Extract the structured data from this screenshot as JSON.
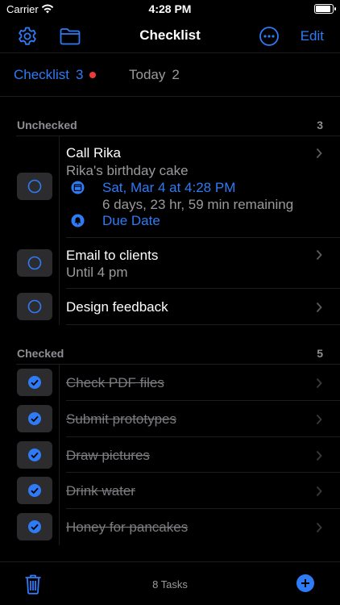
{
  "status_bar": {
    "carrier": "Carrier",
    "time": "4:28 PM"
  },
  "nav": {
    "title": "Checklist",
    "edit_label": "Edit"
  },
  "tabs": [
    {
      "label": "Checklist",
      "count": "3",
      "has_dot": true
    },
    {
      "label": "Today",
      "count": "2"
    }
  ],
  "unchecked": {
    "label": "Unchecked",
    "count": "3",
    "items": [
      {
        "title": "Call Rika",
        "note": "Rika's birthday cake",
        "date": "Sat, Mar 4 at 4:28 PM",
        "remaining": "6 days, 23 hr, 59 min remaining",
        "due_label": "Due Date"
      },
      {
        "title": "Email to clients",
        "note": "Until 4 pm"
      },
      {
        "title": "Design feedback"
      }
    ]
  },
  "checked": {
    "label": "Checked",
    "count": "5",
    "items": [
      {
        "title": "Check PDF files"
      },
      {
        "title": "Submit prototypes"
      },
      {
        "title": "Draw pictures"
      },
      {
        "title": "Drink water"
      },
      {
        "title": "Honey for pancakes"
      }
    ]
  },
  "toolbar": {
    "task_count": "8 Tasks"
  },
  "colors": {
    "accent": "#2f7bf6",
    "dot": "#f03a3a",
    "background": "#000000"
  },
  "icons": [
    "wifi-icon",
    "battery-icon",
    "gear-icon",
    "folder-icon",
    "more-icon",
    "calendar-icon",
    "bell-icon",
    "chevron-right-icon",
    "checkmark-icon",
    "trash-icon",
    "plus-icon"
  ]
}
